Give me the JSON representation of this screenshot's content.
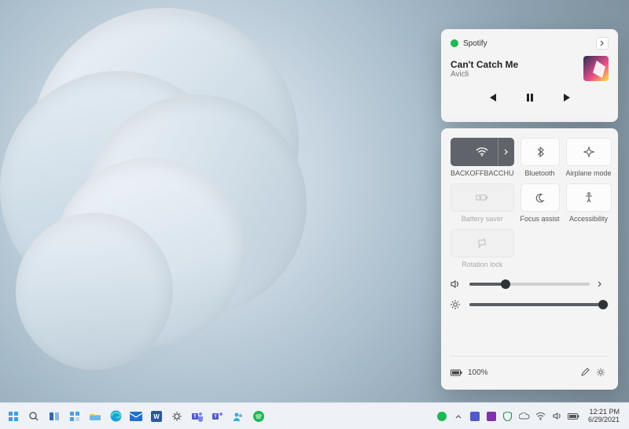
{
  "media": {
    "app": "Spotify",
    "title": "Can't Catch Me",
    "artist": "Avicli"
  },
  "quick_settings": {
    "tiles": [
      {
        "label": "BACKOFFBACCHU",
        "state": "on",
        "icon": "wifi"
      },
      {
        "label": "Bluetooth",
        "state": "off",
        "icon": "bluetooth"
      },
      {
        "label": "Airplane mode",
        "state": "off",
        "icon": "airplane"
      },
      {
        "label": "Battery saver",
        "state": "disabled",
        "icon": "battery-saver"
      },
      {
        "label": "Focus assist",
        "state": "off",
        "icon": "focus"
      },
      {
        "label": "Accessibility",
        "state": "off",
        "icon": "accessibility"
      },
      {
        "label": "Rotation lock",
        "state": "disabled",
        "icon": "rotation"
      }
    ],
    "volume_percent": 30,
    "brightness_percent": 96,
    "battery_text": "100%"
  },
  "tray": {
    "time": "12:21 PM",
    "date": "6/29/2021"
  }
}
